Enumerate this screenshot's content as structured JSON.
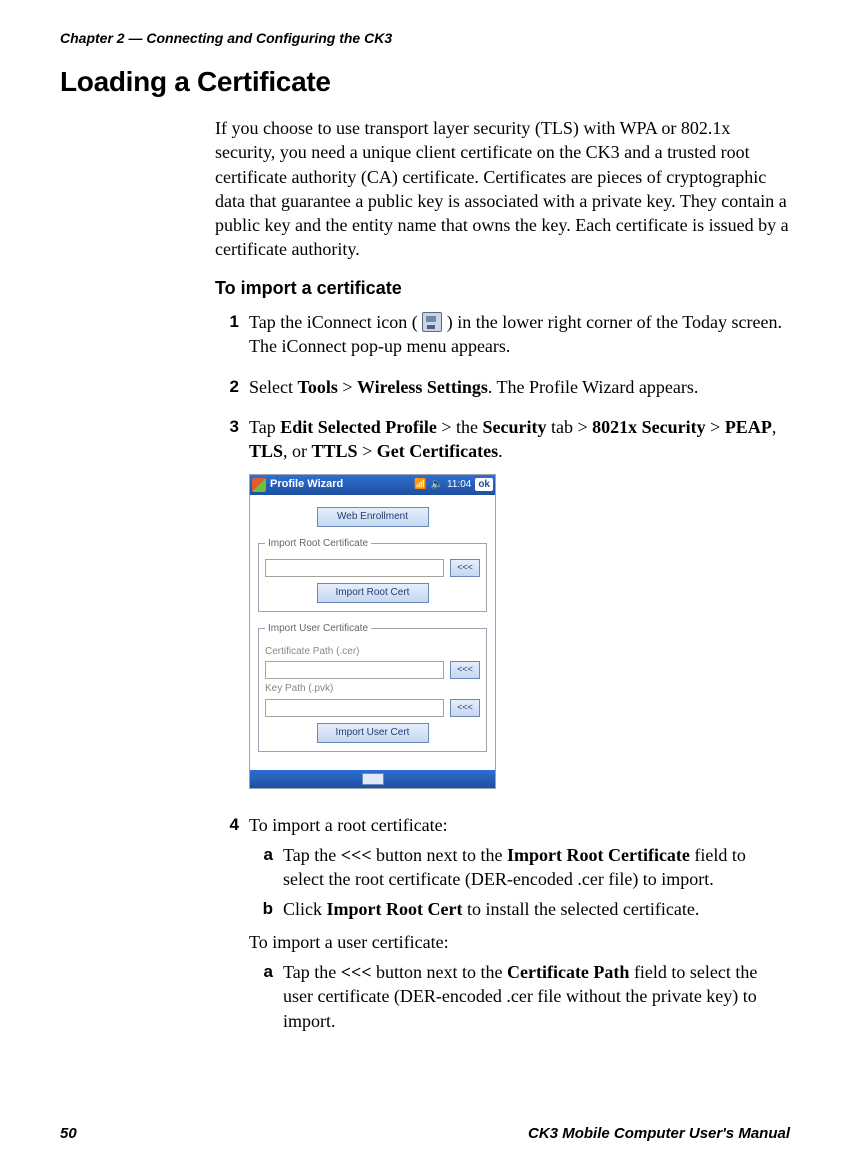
{
  "header": {
    "running": "Chapter 2 — Connecting and Configuring the CK3"
  },
  "section_title": "Loading a Certificate",
  "intro": "If you choose to use transport layer security (TLS) with WPA or 802.1x security, you need a unique client certificate on the CK3 and a trusted root certificate authority (CA) certificate. Certificates are pieces of cryptographic data that guarantee a public key is associated with a private key. They contain a public key and the entity name that owns the key. Each certificate is issued by a certificate authority.",
  "subhead": "To import a certificate",
  "steps": {
    "s1": {
      "num": "1",
      "pre": "Tap the iConnect icon (",
      "post": ") in the lower right corner of the Today screen. The iConnect pop-up menu appears."
    },
    "s2": {
      "num": "2",
      "text_a": "Select ",
      "b1": "Tools",
      "gt1": " > ",
      "b2": "Wireless Settings",
      "text_b": ". The Profile Wizard appears."
    },
    "s3": {
      "num": "3",
      "text_a": "Tap ",
      "b1": "Edit Selected Profile",
      "gt1": " > the ",
      "b2": "Security",
      "text_b": " tab > ",
      "b3": "8021x Security",
      "gt2": " > ",
      "b4": "PEAP",
      "comma": ", ",
      "b5": "TLS",
      "or": ", or ",
      "b6": "TTLS",
      "gt3": " > ",
      "b7": "Get Certificates",
      "dot": "."
    },
    "s4": {
      "num": "4",
      "lead": "To import a root certificate:",
      "a": {
        "num": "a",
        "pre": "Tap the ",
        "btn": "<<<",
        "mid": " button next to the ",
        "bold": "Import Root Certificate",
        "post": " field to select the root certificate (DER-encoded .cer file) to import."
      },
      "b": {
        "num": "b",
        "pre": "Click ",
        "bold": "Import Root Cert",
        "post": " to install the selected certificate."
      },
      "lead2": "To import a user certificate:",
      "a2": {
        "num": "a",
        "pre": "Tap the ",
        "btn": "<<<",
        "mid": " button next to the ",
        "bold": "Certificate Path",
        "post": " field to select the user certificate (DER-encoded .cer file without the private key) to import."
      }
    }
  },
  "wizard": {
    "title": "Profile Wizard",
    "time": "11:04",
    "ok": "ok",
    "web_enrollment": "Web Enrollment",
    "root_legend": "Import Root Certificate",
    "import_root": "Import Root Cert",
    "user_legend": "Import User Certificate",
    "cert_path": "Certificate Path (.cer)",
    "key_path": "Key Path (.pvk)",
    "import_user": "Import User Cert",
    "chev": "<<<"
  },
  "footer": {
    "page": "50",
    "title": "CK3 Mobile Computer User's Manual"
  }
}
